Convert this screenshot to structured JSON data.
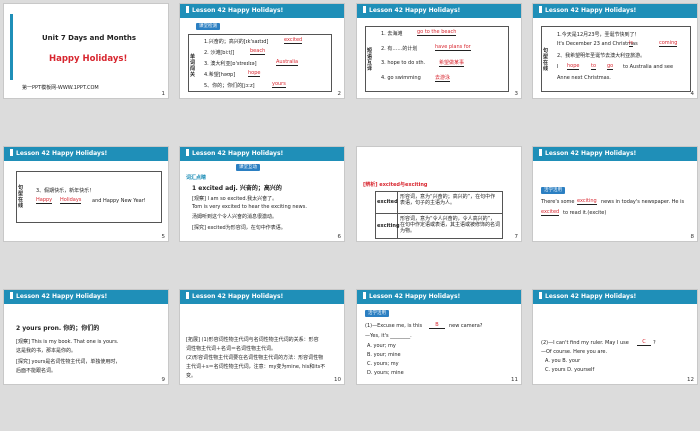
{
  "lesson_header": "Lesson 42    Happy Holidays!",
  "slides": {
    "s1": {
      "title": "Unit 7  Days and Months",
      "subtitle": "Happy Holidays!",
      "footer": "第一PPT模板网-WWW.1PPT.COM",
      "num": "1"
    },
    "s2": {
      "tag": "课堂检测",
      "side": "单词闯关",
      "lines": [
        "1.兴奋的；高兴的[ɪk'saɪtɪd]",
        "2. 沙滩[biːtʃ]",
        "3. 澳大利亚[ɒ'streɪlɪə]",
        "4.希望[həʊp]",
        "5、你的；你们的[jɔːz]"
      ],
      "answers": [
        "excited",
        "beach",
        "Australia",
        "hope",
        "yours"
      ],
      "num": "2"
    },
    "s3": {
      "side": "短语互译",
      "lines": [
        "1.  去海滩",
        "2.  有……的计划",
        "3.  hope to do sth.",
        "4.  go swimming"
      ],
      "answers": [
        "go to the beach",
        "have plans for",
        "希望做某事",
        "去游泳"
      ],
      "num": "3"
    },
    "s4": {
      "side": "句型在线",
      "l1": "1.今天是12月23号，圣诞节快到了！",
      "l2a": "It's December  23 and Christmas",
      "l2b": "is",
      "l2c": "coming",
      "l3": "2、我希望明年圣诞节去澳大利亚旅游。",
      "l4a": "I",
      "l4b": "hope",
      "l4c": "to",
      "l4d": "go",
      "l4e": "to Australia and see",
      "l5": "Anne next Christmas.",
      "num": "4"
    },
    "s5": {
      "side": "句型在线",
      "l1": "3、假期快乐，新年快乐！",
      "l2a": "Happy",
      "l2b": "Holidays",
      "l2c": "and Happy New Year!",
      "num": "5"
    },
    "s6": {
      "tag": "课堂互动",
      "sub": "词汇点睛",
      "heading": "1     excited adj. 兴奋的；高兴的",
      "l1": "[观察] I am so excited.我太兴奋了。",
      "l2": "Tom is very excited to hear the exciting news.",
      "l3": "汤姆听到这个令人兴奋的消息很激动。",
      "l4": "[探究] excited为形容词，在句中作表语。",
      "num": "6"
    },
    "s7": {
      "top": "[辨析] excited与exciting",
      "r1k": "excited",
      "r1v": "形容词，意为“兴奋的；高兴的”，在句中作表语，句子的主语为人。",
      "r2k": "exciting",
      "r2v": "形容词，意为“令人兴奋的，令人高兴的”，在句中作定语或表语，其主语或被修饰的名词为物。",
      "num": "7"
    },
    "s8": {
      "tag": "活学活用",
      "l1a": "There's some",
      "l1b": "exciting",
      "l1c": "news in today's newspaper. He is",
      "l2a": "excited",
      "l2b": "to read it.(excite)",
      "num": "8"
    },
    "s9": {
      "heading": "2     yours pron. 你的；你们的",
      "l1": "[观察] This is my book. That one is yours.",
      "l2": "这是我的书，那本是你的。",
      "l3": "[探究] yours是名词性物主代词，单独使用时，",
      "l4": "后面不能跟名词。",
      "num": "9"
    },
    "s10": {
      "l1": "[拓展] (1)形容词性物主代词与名词性物主代词的关系：形容",
      "l2": "词性物主代词＋名词＝名词性物主代词。",
      "l3": "(2)形容词性物主代词要在名词性物主代词的方法：形容词性物",
      "l4": "主代词＋s＝名词性物主代词，注意：my变为mine, his和its不",
      "l5": "变。",
      "num": "10"
    },
    "s11": {
      "tag": "活学活用",
      "l1a": "(1)—Excuse me, is this",
      "l1b": "B",
      "l1c": "new camera?",
      "l2": "—Yes, it's ________.",
      "opts": [
        "A. your; my",
        "B. your; mine",
        "C. yours; my",
        "D. yours; mine"
      ],
      "num": "11"
    },
    "s12": {
      "l1a": "(2)—I can't find my ruler. May I use",
      "l1b": "C",
      "l1c": "?",
      "l2": "—Of course. Here you are.",
      "l3": "A. you     B. your",
      "l4": "C. yours  D. yourself",
      "num": "12"
    }
  }
}
